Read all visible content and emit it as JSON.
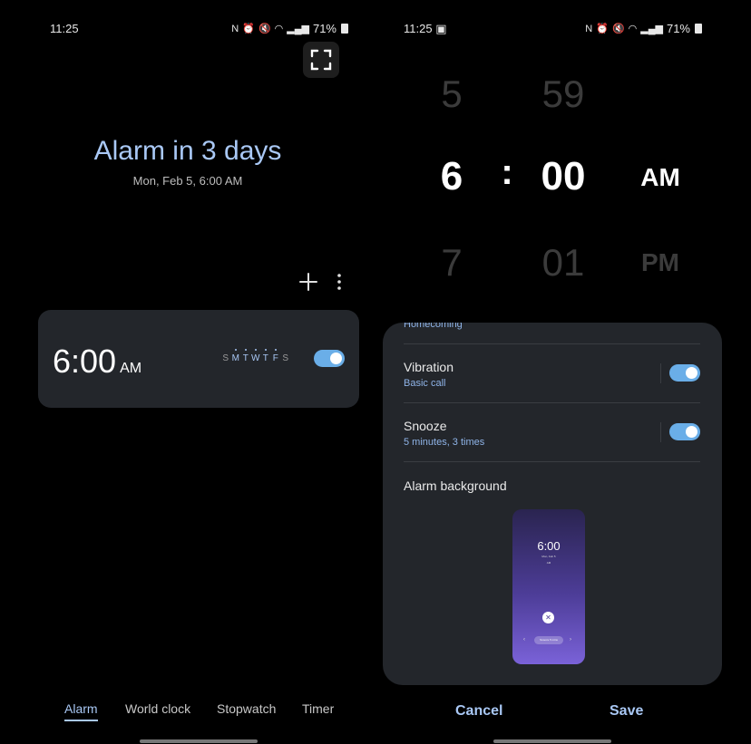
{
  "left": {
    "status": {
      "time": "11:25",
      "battery": "71%"
    },
    "header": {
      "title": "Alarm in 3 days",
      "subtitle": "Mon, Feb 5, 6:00 AM"
    },
    "toolbar": {
      "add_icon": "plus-icon",
      "more_icon": "more-vertical-icon"
    },
    "alarm": {
      "time": "6:00",
      "ampm": "AM",
      "enabled": true,
      "days": [
        {
          "label": "S",
          "on": false
        },
        {
          "label": "M",
          "on": true
        },
        {
          "label": "T",
          "on": true
        },
        {
          "label": "W",
          "on": true
        },
        {
          "label": "T",
          "on": true
        },
        {
          "label": "F",
          "on": true
        },
        {
          "label": "S",
          "on": false
        }
      ]
    },
    "tabs": [
      "Alarm",
      "World clock",
      "Stopwatch",
      "Timer"
    ],
    "active_tab": "Alarm"
  },
  "right": {
    "status": {
      "time": "11:25",
      "battery": "71%"
    },
    "picker": {
      "hour_prev": "5",
      "hour": "6",
      "hour_next": "7",
      "separator": ":",
      "minute_prev": "59",
      "minute": "00",
      "minute_next": "01",
      "ampm": "AM",
      "ampm_next": "PM"
    },
    "settings": {
      "partial_top": "Homecoming",
      "vibration": {
        "title": "Vibration",
        "sub": "Basic call",
        "enabled": true
      },
      "snooze": {
        "title": "Snooze",
        "sub": "5 minutes, 3 times",
        "enabled": true
      },
      "background": {
        "title": "Alarm background",
        "preview_time": "6:00",
        "preview_date": "Mon, Feb 5",
        "preview_ampm": "AM",
        "preview_snooze": "Snooze 5 mins"
      }
    },
    "actions": {
      "cancel": "Cancel",
      "save": "Save"
    }
  },
  "colors": {
    "accent": "#a9c8f5",
    "toggle": "#6aaee8",
    "card": "#23262b"
  }
}
